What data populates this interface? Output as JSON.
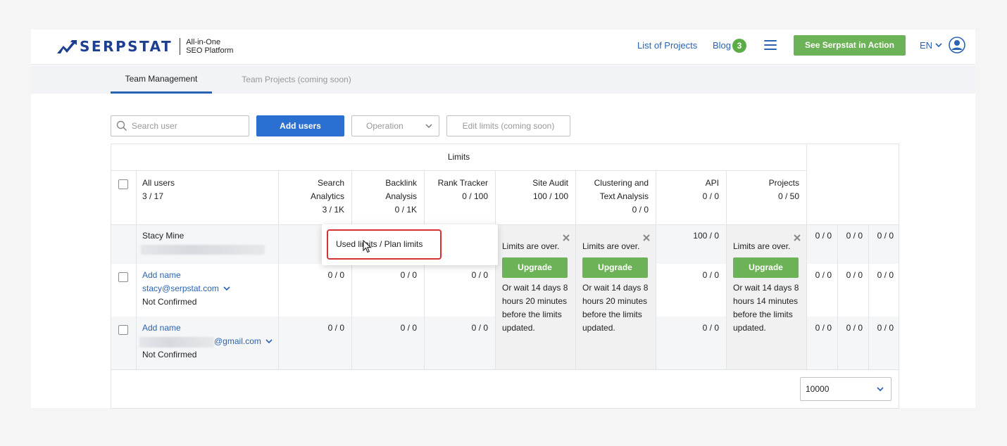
{
  "header": {
    "logo_word": "SERPSTAT",
    "logo_tag_line1": "All-in-One",
    "logo_tag_line2": "SEO Platform",
    "nav_projects": "List of Projects",
    "nav_blog": "Blog",
    "blog_count": "3",
    "cta_label": "See Serpstat in Action",
    "lang": "EN",
    "icons": [
      "serpstat-logo-icon",
      "hamburger-menu-icon",
      "chevron-down-icon",
      "user-avatar-icon"
    ],
    "colors": {
      "brand": "#1d3f8f",
      "link": "#2a63b3",
      "green": "#6cb256"
    }
  },
  "tabs": [
    {
      "label": "Team Management",
      "active": true
    },
    {
      "label": "Team Projects (coming soon)",
      "active": false
    }
  ],
  "toolbar": {
    "search_placeholder": "Search user",
    "add_users": "Add users",
    "operation": "Operation",
    "edit_limits": "Edit limits (coming soon)"
  },
  "table": {
    "limits_title": "Limits",
    "all_users_label": "All users",
    "all_users_count": "3 / 17",
    "columns": [
      {
        "line1": "Search",
        "line2": "Analytics",
        "value": "3 / 1K"
      },
      {
        "line1": "Backlink",
        "line2": "Analysis",
        "value": "0 / 1K"
      },
      {
        "line1": "Rank Tracker",
        "line2": "",
        "value": "0 / 100"
      },
      {
        "line1": "Site Audit",
        "line2": "",
        "value": "100 / 100"
      },
      {
        "line1": "Clustering and",
        "line2": "Text Analysis",
        "value": "0 / 0"
      },
      {
        "line1": "API",
        "line2": "",
        "value": "0 / 0"
      },
      {
        "line1": "Projects",
        "line2": "",
        "value": "0 / 50"
      }
    ],
    "rows": [
      {
        "name": "Stacy Mine",
        "email": "",
        "status": "",
        "values": [
          "",
          "",
          "",
          "",
          "",
          "100 / 0",
          "",
          "0 / 0",
          "0 / 0",
          "0 / 0"
        ]
      },
      {
        "name": "Add name",
        "email": "stacy@serpstat.com",
        "status": "Not Confirmed",
        "values": [
          "0 / 0",
          "0 / 0",
          "0 / 0",
          "",
          "",
          "0 / 0",
          "",
          "0 / 0",
          "0 / 0",
          "0 / 0"
        ]
      },
      {
        "name": "Add name",
        "email": "@gmail.com",
        "status": "Not Confirmed",
        "values": [
          "0 / 0",
          "0 / 0",
          "0 / 0",
          "",
          "",
          "0 / 0",
          "",
          "0 / 0",
          "0 / 0",
          "0 / 0"
        ]
      }
    ],
    "limit_over": {
      "title": "Limits over.",
      "title_full": "Limits are over.",
      "upgrade": "Upgrade",
      "wait_a_lines": [
        "Or wait 14 days 8",
        "hours 20 minutes",
        "before the limits",
        "updated."
      ],
      "wait_b_lines": [
        "Or wait 14 days 8",
        "hours 14 minutes",
        "before the limits",
        "updated."
      ]
    },
    "tooltip": "Used limits / Plan limits",
    "per_page": "10000"
  }
}
